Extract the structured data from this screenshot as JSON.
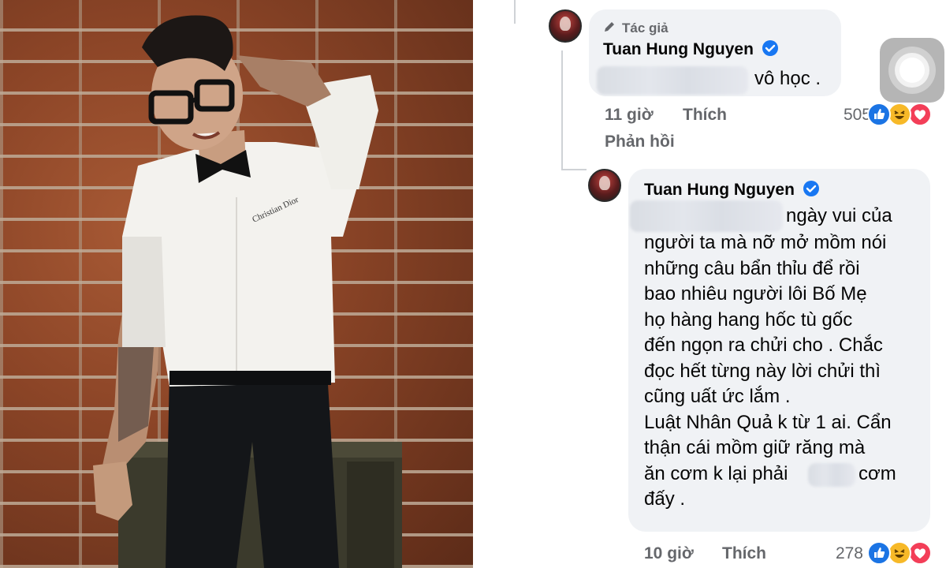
{
  "comment1": {
    "author_tag": "Tác giả",
    "author_name": "Tuan Hung Nguyen",
    "text": "vô học .",
    "time": "11 giờ",
    "like_label": "Thích",
    "reply_label": "Phản hồi",
    "reaction_count": "505",
    "reactions": [
      "like",
      "haha",
      "love"
    ]
  },
  "comment2": {
    "author_name": "Tuan Hung Nguyen",
    "lines": [
      "ngày vui của",
      "người ta mà nỡ mở mồm nói",
      "những câu bẩn thỉu để rồi",
      "bao nhiêu người lôi Bố Mẹ",
      "họ hàng hang hốc tù gốc",
      "đến ngọn ra chửi cho . Chắc",
      "đọc hết từng này lời chửi thì",
      "cũng uất ức lắm .",
      "Luật Nhân Quả k từ 1 ai. Cẩn",
      "thận cái mồm giữ răng mà",
      "ăn cơm k lại phải",
      "cơm",
      "đấy ."
    ],
    "time": "10 giờ",
    "like_label": "Thích",
    "reaction_count": "278",
    "reactions": [
      "like",
      "haha",
      "love"
    ]
  },
  "colors": {
    "bubble": "#f0f2f5",
    "meta_text": "#65676b",
    "verified": "#1877f2",
    "like": "#1b74e4",
    "haha": "#f7b928",
    "love": "#f33e58"
  },
  "photo": {
    "shirt_print": "Christian Dior"
  },
  "icons": {
    "author_tag": "pen-icon",
    "verified": "verified-badge-icon",
    "assistive": "assistive-touch-icon"
  }
}
